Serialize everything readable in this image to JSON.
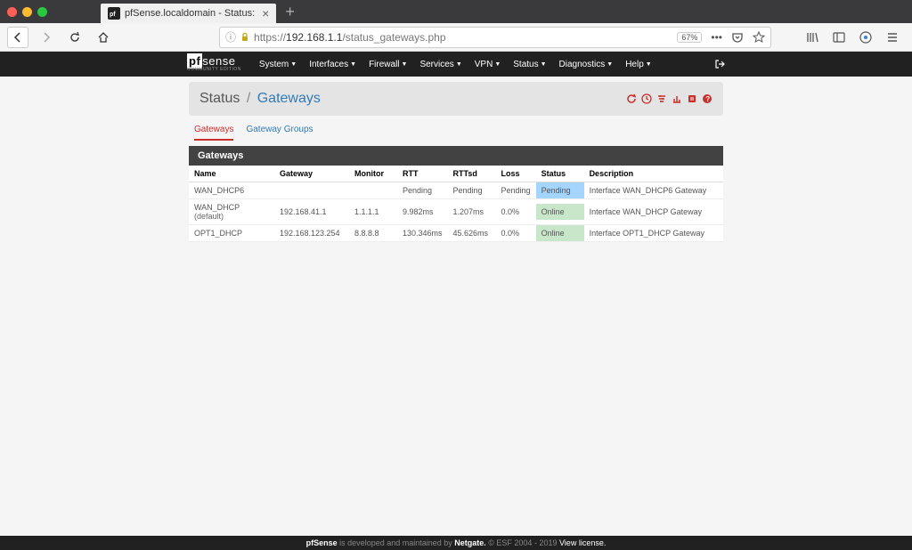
{
  "browser": {
    "tab_title": "pfSense.localdomain - Status:",
    "url_prefix": "https://",
    "url_host": "192.168.1.1",
    "url_path": "/status_gateways.php",
    "zoom": "67%"
  },
  "logo": {
    "pf": "pf",
    "sense": "sense",
    "sub": "COMMUNITY EDITION"
  },
  "nav": {
    "system": "System",
    "interfaces": "Interfaces",
    "firewall": "Firewall",
    "services": "Services",
    "vpn": "VPN",
    "status": "Status",
    "diagnostics": "Diagnostics",
    "help": "Help"
  },
  "breadcrumb": {
    "parent": "Status",
    "sep": "/",
    "current": "Gateways"
  },
  "subtabs": {
    "gateways": "Gateways",
    "groups": "Gateway Groups"
  },
  "panel_title": "Gateways",
  "columns": {
    "name": "Name",
    "gateway": "Gateway",
    "monitor": "Monitor",
    "rtt": "RTT",
    "rttsd": "RTTsd",
    "loss": "Loss",
    "status": "Status",
    "description": "Description"
  },
  "rows": [
    {
      "name": "WAN_DHCP6",
      "default": "",
      "gateway": "",
      "monitor": "",
      "rtt": "Pending",
      "rttsd": "Pending",
      "loss": "Pending",
      "status": "Pending",
      "status_class": "status-pending",
      "description": "Interface WAN_DHCP6 Gateway"
    },
    {
      "name": "WAN_DHCP",
      "default": "(default)",
      "gateway": "192.168.41.1",
      "monitor": "1.1.1.1",
      "rtt": "9.982ms",
      "rttsd": "1.207ms",
      "loss": "0.0%",
      "status": "Online",
      "status_class": "status-online",
      "description": "Interface WAN_DHCP Gateway"
    },
    {
      "name": "OPT1_DHCP",
      "default": "",
      "gateway": "192.168.123.254",
      "monitor": "8.8.8.8",
      "rtt": "130.346ms",
      "rttsd": "45.626ms",
      "loss": "0.0%",
      "status": "Online",
      "status_class": "status-online",
      "description": "Interface OPT1_DHCP Gateway"
    }
  ],
  "footer": {
    "p1": "pfSense",
    "p2": " is developed and maintained by ",
    "p3": "Netgate.",
    "p4": " © ESF 2004 - 2019 ",
    "p5": "View license."
  }
}
